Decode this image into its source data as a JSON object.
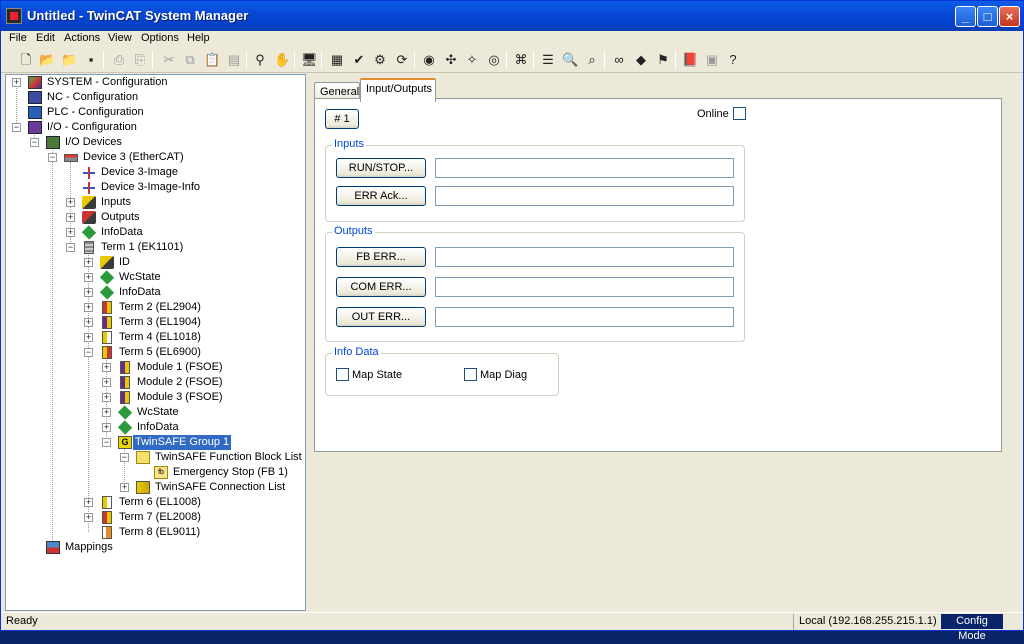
{
  "window": {
    "title": "Untitled - TwinCAT System Manager",
    "controls": {
      "minimize": "_",
      "maximize": "□",
      "close": "×"
    }
  },
  "menu": [
    "File",
    "Edit",
    "Actions",
    "View",
    "Options",
    "Help"
  ],
  "toolbar": {
    "icons": [
      "new-icon",
      "open-icon",
      "open-folder-icon",
      "save-icon",
      "print-icon",
      "print-preview-icon",
      "cut-icon",
      "copy-icon",
      "paste-icon",
      "find-icon",
      "hand-icon",
      "monitor-icon",
      "build-icon",
      "check-icon",
      "activate-icon",
      "restart-icon",
      "scan-icon",
      "restart-config-icon",
      "wand-icon",
      "target-icon",
      "plug-icon",
      "list-icon",
      "zoom-icon",
      "zoom-box-icon",
      "glasses-icon",
      "online-icon",
      "diag-icon",
      "book-icon",
      "refresh-icon",
      "help-icon"
    ]
  },
  "tree": {
    "items": [
      {
        "label": "SYSTEM - Configuration",
        "icon": "system-icon"
      },
      {
        "label": "NC - Configuration",
        "icon": "nc-icon"
      },
      {
        "label": "PLC - Configuration",
        "icon": "plc-icon"
      },
      {
        "label": "I/O - Configuration",
        "icon": "io-icon"
      },
      {
        "label": "I/O Devices",
        "icon": "io-devices-icon"
      },
      {
        "label": "Device 3 (EtherCAT)",
        "icon": "ethercat-device-icon"
      },
      {
        "label": "Device 3-Image",
        "icon": "image-icon"
      },
      {
        "label": "Device 3-Image-Info",
        "icon": "image-info-icon"
      },
      {
        "label": "Inputs",
        "icon": "inputs-icon"
      },
      {
        "label": "Outputs",
        "icon": "outputs-icon"
      },
      {
        "label": "InfoData",
        "icon": "infodata-icon"
      },
      {
        "label": "Term 1 (EK1101)",
        "icon": "terminal-icon"
      },
      {
        "label": "ID",
        "icon": "inputs-icon"
      },
      {
        "label": "WcState",
        "icon": "infodata-icon"
      },
      {
        "label": "InfoData",
        "icon": "infodata-icon"
      },
      {
        "label": "Term 2 (EL2904)",
        "icon": "terminal-icon"
      },
      {
        "label": "Term 3 (EL1904)",
        "icon": "terminal-icon"
      },
      {
        "label": "Term 4 (EL1018)",
        "icon": "terminal-icon"
      },
      {
        "label": "Term 5 (EL6900)",
        "icon": "terminal-icon"
      },
      {
        "label": "Module 1 (FSOE)",
        "icon": "module-icon"
      },
      {
        "label": "Module 2 (FSOE)",
        "icon": "module-icon"
      },
      {
        "label": "Module 3 (FSOE)",
        "icon": "module-icon"
      },
      {
        "label": "WcState",
        "icon": "infodata-icon"
      },
      {
        "label": "InfoData",
        "icon": "infodata-icon"
      },
      {
        "label": "TwinSAFE Group 1",
        "icon": "group-icon"
      },
      {
        "label": "TwinSAFE Function Block List",
        "icon": "function-block-list-icon"
      },
      {
        "label": "Emergency Stop (FB 1)",
        "icon": "function-block-icon"
      },
      {
        "label": "TwinSAFE Connection List",
        "icon": "connection-list-icon"
      },
      {
        "label": "Term 6 (EL1008)",
        "icon": "terminal-icon"
      },
      {
        "label": "Term 7 (EL2008)",
        "icon": "terminal-icon"
      },
      {
        "label": "Term 8 (EL9011)",
        "icon": "terminal-icon"
      },
      {
        "label": "Mappings",
        "icon": "mappings-icon"
      }
    ],
    "group_icon_text": "G",
    "fb_icon_text": "fb"
  },
  "tabs": {
    "general": "General",
    "io": "Input/Outputs"
  },
  "panel": {
    "number_button": "# 1",
    "online_label": "Online",
    "online_checked": false,
    "inputs_group": "Inputs",
    "run_stop_button": "RUN/STOP...",
    "run_stop_value": "",
    "err_ack_button": "ERR Ack...",
    "err_ack_value": "",
    "outputs_group": "Outputs",
    "fb_err_button": "FB ERR...",
    "fb_err_value": "",
    "com_err_button": "COM ERR...",
    "com_err_value": "",
    "out_err_button": "OUT ERR...",
    "out_err_value": "",
    "info_group": "Info Data",
    "map_state_label": "Map State",
    "map_state_checked": false,
    "map_diag_label": "Map Diag",
    "map_diag_checked": false
  },
  "status": {
    "text": "Ready",
    "address": "Local (192.168.255.215.1.1)",
    "mode": "Config Mode"
  }
}
